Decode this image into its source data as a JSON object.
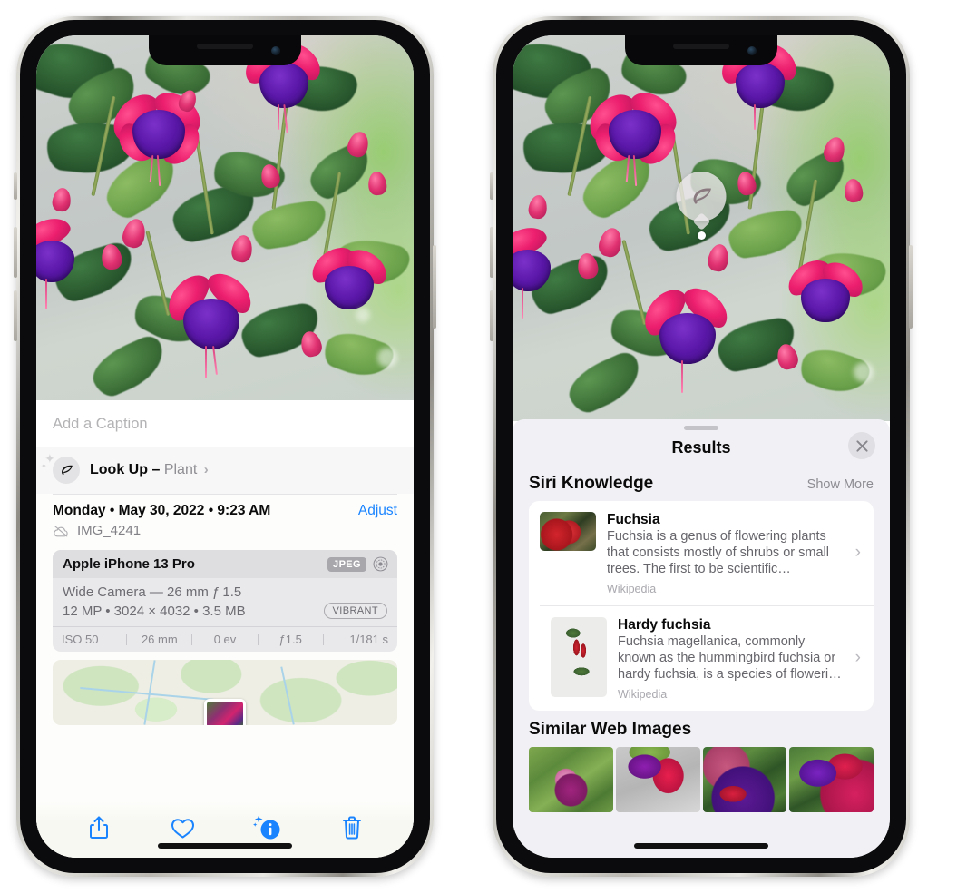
{
  "left_phone": {
    "name": "iphone-photos-info",
    "caption_placeholder": "Add a Caption",
    "lookup": {
      "label": "Look Up",
      "dash": "–",
      "subject": "Plant",
      "chevron": "›",
      "icon": "leaf-icon"
    },
    "meta": {
      "date": "Monday • May 30, 2022 • 9:23 AM",
      "adjust_label": "Adjust",
      "filename": "IMG_4241",
      "cloud_icon": "cloud-slash-icon"
    },
    "exif": {
      "device": "Apple iPhone 13 Pro",
      "format_tag": "JPEG",
      "raw_icon": "raw-aperture-icon",
      "lens": "Wide Camera — 26 mm ƒ 1.5",
      "size_line": "12 MP • 3024 × 4032 • 3.5 MB",
      "style_tag": "VIBRANT",
      "stats": [
        "ISO 50",
        "26 mm",
        "0 ev",
        "ƒ1.5",
        "1/181 s"
      ]
    },
    "map": {
      "name": "location-map-thumbnail"
    },
    "toolbar": [
      {
        "name": "share-button",
        "icon": "share-icon"
      },
      {
        "name": "favorite-button",
        "icon": "heart-icon"
      },
      {
        "name": "info-button",
        "icon": "info-sparkle-icon"
      },
      {
        "name": "delete-button",
        "icon": "trash-icon"
      }
    ]
  },
  "right_phone": {
    "name": "iphone-visual-lookup-results",
    "badge": {
      "icon": "leaf-icon",
      "name": "visual-lookup-badge"
    },
    "sheet": {
      "title": "Results",
      "close_icon": "close-icon",
      "sections": [
        {
          "title": "Siri Knowledge",
          "action": "Show More",
          "cards": [
            {
              "title": "Fuchsia",
              "snippet": "Fuchsia is a genus of flowering plants that consists mostly of shrubs or small trees. The first to be scientific…",
              "source": "Wikipedia",
              "chevron": "›"
            },
            {
              "title": "Hardy fuchsia",
              "snippet": "Fuchsia magellanica, commonly known as the hummingbird fuchsia or hardy fuchsia, is a species of floweri…",
              "source": "Wikipedia",
              "chevron": "›"
            }
          ]
        },
        {
          "title": "Similar Web Images",
          "thumbnails": [
            {
              "name": "web-image-1"
            },
            {
              "name": "web-image-2"
            },
            {
              "name": "web-image-3"
            },
            {
              "name": "web-image-4"
            }
          ]
        }
      ]
    }
  },
  "colors": {
    "accent_blue": "#1a84ff",
    "sheet_bg": "#f1f1f5",
    "card_bg": "#ffffff",
    "secondary_text": "#8e8e93"
  }
}
